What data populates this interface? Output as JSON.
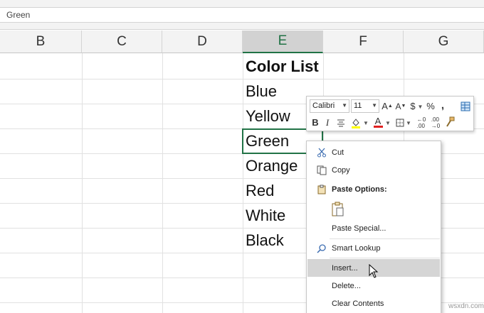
{
  "formula_bar": {
    "value": "Green"
  },
  "columns": [
    {
      "label": "B",
      "active": false
    },
    {
      "label": "C",
      "active": false
    },
    {
      "label": "D",
      "active": false
    },
    {
      "label": "E",
      "active": true
    },
    {
      "label": "F",
      "active": false
    },
    {
      "label": "G",
      "active": false
    }
  ],
  "cells": {
    "header": "Color List",
    "items": [
      "Blue",
      "Yellow",
      "Green",
      "Orange",
      "Red",
      "White",
      "Black"
    ],
    "selected": "Green"
  },
  "mini_toolbar": {
    "font_name": "Calibri",
    "font_size": "11",
    "bold_label": "B",
    "italic_label": "I",
    "currency_label": "$",
    "percent_label": "%",
    "comma_label": ",",
    "font_color_label": "A",
    "highlight_color": "#ffff00",
    "font_color": "#e02020"
  },
  "context_menu": {
    "cut": "Cut",
    "copy": "Copy",
    "paste_options": "Paste Options:",
    "paste_special": "Paste Special...",
    "smart_lookup": "Smart Lookup",
    "insert": "Insert...",
    "delete": "Delete...",
    "clear_contents": "Clear Contents"
  },
  "watermark": "wsxdn.com",
  "colors": {
    "accent": "#217346",
    "menu_hover": "#d5d5d5"
  }
}
